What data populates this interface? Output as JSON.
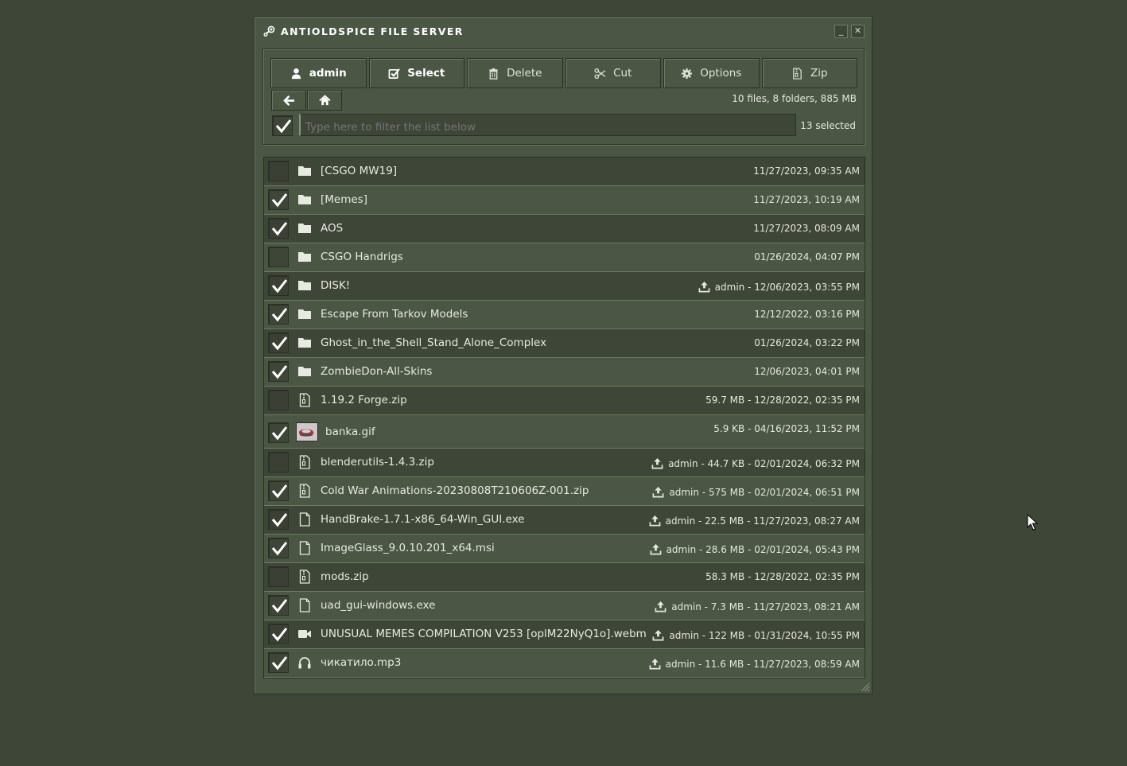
{
  "window": {
    "title": "ANTIOLDSPICE FILE SERVER",
    "minimize_label": "_",
    "close_label": "✕"
  },
  "toolbar": {
    "buttons": [
      {
        "label": "admin",
        "icon": "user-icon",
        "bold": true
      },
      {
        "label": "Select",
        "icon": "checkbox-icon",
        "bold": true
      },
      {
        "label": "Delete",
        "icon": "trash-icon",
        "bold": false
      },
      {
        "label": "Cut",
        "icon": "scissors-icon",
        "bold": false
      },
      {
        "label": "Options",
        "icon": "gear-icon",
        "bold": false
      },
      {
        "label": "Zip",
        "icon": "zip-icon",
        "bold": false
      }
    ],
    "summary": "10 files, 8 folders, 885 MB",
    "filter_placeholder": "Type here to filter the list below",
    "select_all_checked": true,
    "selected_count": "13 selected"
  },
  "files": [
    {
      "name": "[CSGO MW19]",
      "type": "folder",
      "checked": false,
      "meta": "11/27/2023, 09:35 AM",
      "uploaded": false
    },
    {
      "name": "[Memes]",
      "type": "folder",
      "checked": true,
      "meta": "11/27/2023, 10:19 AM",
      "uploaded": false
    },
    {
      "name": "AOS",
      "type": "folder",
      "checked": true,
      "meta": "11/27/2023, 08:09 AM",
      "uploaded": false
    },
    {
      "name": "CSGO Handrigs",
      "type": "folder",
      "checked": false,
      "meta": "01/26/2024, 04:07 PM",
      "uploaded": false
    },
    {
      "name": "DISK!",
      "type": "folder",
      "checked": true,
      "meta": "admin - 12/06/2023, 03:55 PM",
      "uploaded": true
    },
    {
      "name": "Escape From Tarkov Models",
      "type": "folder",
      "checked": true,
      "meta": "12/12/2022, 03:16 PM",
      "uploaded": false
    },
    {
      "name": "Ghost_in_the_Shell_Stand_Alone_Complex",
      "type": "folder",
      "checked": true,
      "meta": "01/26/2024, 03:22 PM",
      "uploaded": false
    },
    {
      "name": "ZombieDon-All-Skins",
      "type": "folder",
      "checked": true,
      "meta": "12/06/2023, 04:01 PM",
      "uploaded": false
    },
    {
      "name": "1.19.2 Forge.zip",
      "type": "zip",
      "checked": false,
      "meta": "59.7 MB - 12/28/2022, 02:35 PM",
      "uploaded": false
    },
    {
      "name": "banka.gif",
      "type": "image",
      "checked": true,
      "meta": "5.9 KB - 04/16/2023, 11:52 PM",
      "uploaded": false
    },
    {
      "name": "blenderutils-1.4.3.zip",
      "type": "zip",
      "checked": false,
      "meta": "admin - 44.7 KB - 02/01/2024, 06:32 PM",
      "uploaded": true
    },
    {
      "name": "Cold War Animations-20230808T210606Z-001.zip",
      "type": "zip",
      "checked": true,
      "meta": "admin - 575 MB - 02/01/2024, 06:51 PM",
      "uploaded": true
    },
    {
      "name": "HandBrake-1.7.1-x86_64-Win_GUI.exe",
      "type": "file",
      "checked": true,
      "meta": "admin - 22.5 MB - 11/27/2023, 08:27 AM",
      "uploaded": true
    },
    {
      "name": "ImageGlass_9.0.10.201_x64.msi",
      "type": "file",
      "checked": true,
      "meta": "admin - 28.6 MB - 02/01/2024, 05:43 PM",
      "uploaded": true
    },
    {
      "name": "mods.zip",
      "type": "zip",
      "checked": false,
      "meta": "58.3 MB - 12/28/2022, 02:35 PM",
      "uploaded": false
    },
    {
      "name": "uad_gui-windows.exe",
      "type": "file",
      "checked": true,
      "meta": "admin - 7.3 MB - 11/27/2023, 08:21 AM",
      "uploaded": true
    },
    {
      "name": "UNUSUAL MEMES COMPILATION V253 [oplM22NyQ1o].webm",
      "type": "video",
      "checked": true,
      "meta": "admin - 122 MB - 01/31/2024, 10:55 PM",
      "uploaded": true
    },
    {
      "name": "чикатило.mp3",
      "type": "audio",
      "checked": true,
      "meta": "admin - 11.6 MB - 11/27/2023, 08:59 AM",
      "uploaded": true
    }
  ],
  "colors": {
    "background": "#3e4637",
    "panel": "#4b5744",
    "border_dark": "#2a3026",
    "border_light": "#6c7a63",
    "text": "#dfe3d8"
  }
}
